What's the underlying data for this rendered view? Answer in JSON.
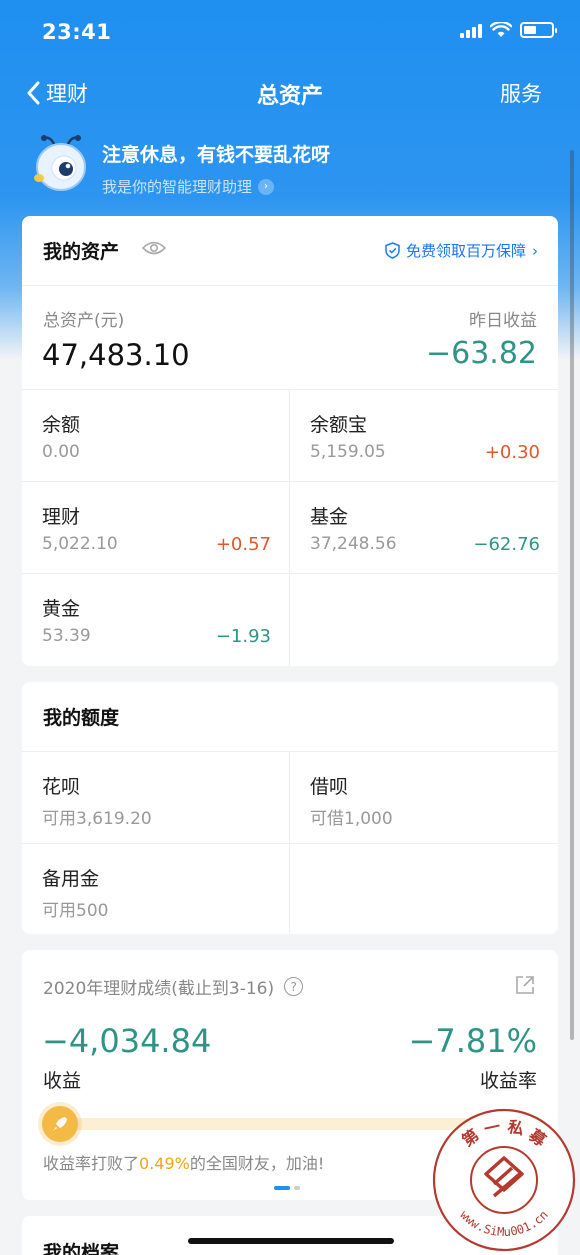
{
  "status": {
    "time": "23:41"
  },
  "nav": {
    "back_label": "理财",
    "title": "总资产",
    "service_label": "服务"
  },
  "assistant": {
    "title": "注意休息，有钱不要乱花呀",
    "subtitle": "我是你的智能理财助理"
  },
  "assets": {
    "title": "我的资产",
    "guarantee_label": "免费领取百万保障",
    "total_label": "总资产(元)",
    "total_value": "47,483.10",
    "yesterday_label": "昨日收益",
    "yesterday_value": "−63.82",
    "items": [
      {
        "name": "余额",
        "value": "0.00",
        "change": ""
      },
      {
        "name": "余额宝",
        "value": "5,159.05",
        "change": "+0.30"
      },
      {
        "name": "理财",
        "value": "5,022.10",
        "change": "+0.57"
      },
      {
        "name": "基金",
        "value": "37,248.56",
        "change": "−62.76"
      },
      {
        "name": "黄金",
        "value": "53.39",
        "change": "−1.93"
      }
    ]
  },
  "credit": {
    "title": "我的额度",
    "items": [
      {
        "name": "花呗",
        "value": "可用3,619.20"
      },
      {
        "name": "借呗",
        "value": "可借1,000"
      },
      {
        "name": "备用金",
        "value": "可用500"
      }
    ]
  },
  "performance": {
    "title": "2020年理财成绩(截止到3-16)",
    "profit_value": "−4,034.84",
    "profit_label": "收益",
    "rate_value": "−7.81%",
    "rate_label": "收益率",
    "beat_prefix": "收益率打败了",
    "beat_percent": "0.49%",
    "beat_suffix": "的全国财友，加油!"
  },
  "archive": {
    "title": "我的档案"
  },
  "watermark": {
    "top_text": "第 一 私 募",
    "url_text": "www.SiMu001.cn"
  },
  "colors": {
    "brand_blue": "#1f8ff0",
    "positive": "#e2572b",
    "negative": "#2f9486",
    "highlight": "#f0a41c"
  }
}
